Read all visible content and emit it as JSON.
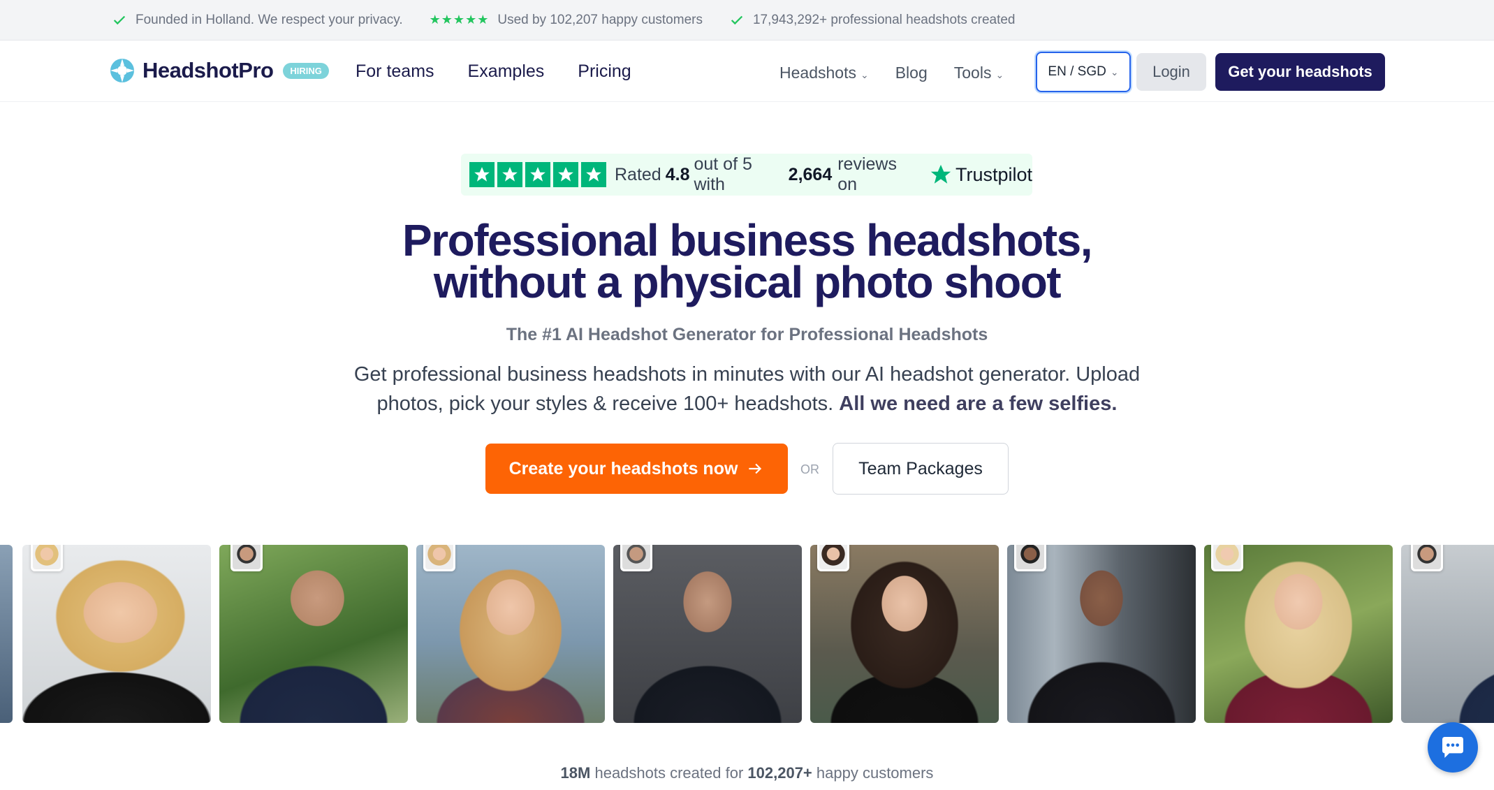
{
  "topbar": {
    "privacy": "Founded in Holland. We respect your privacy.",
    "stars": "★★★★★",
    "customers": "Used by 102,207 happy customers",
    "created": "17,943,292+ professional headshots created"
  },
  "nav": {
    "logo": "HeadshotPro",
    "hiring": "HIRING",
    "links": [
      "For teams",
      "Examples",
      "Pricing"
    ],
    "headshots": "Headshots",
    "blog": "Blog",
    "tools": "Tools",
    "lang": "EN / SGD",
    "login": "Login",
    "cta": "Get your headshots"
  },
  "trust": {
    "prefix": "Rated",
    "rating": "4.8",
    "mid": "out of 5 with",
    "count": "2,664",
    "suffix": "reviews on",
    "brand": "Trustpilot"
  },
  "hero": {
    "title_line1": "Professional business headshots,",
    "title_line2": "without a physical photo shoot",
    "subhead": "The #1 AI Headshot Generator for Professional Headshots",
    "desc": "Get professional business headshots in minutes with our AI headshot generator. Upload photos, pick your styles & receive 100+ headshots.",
    "desc_bold": "All we need are a few selfies.",
    "cta": "Create your headshots now",
    "or": "OR",
    "team": "Team Packages"
  },
  "stats": {
    "count": "18M",
    "mid": "headshots created for",
    "customers": "102,207+",
    "suffix": "happy customers"
  },
  "colors": {
    "brand": "#1e1b5e",
    "accent": "#fd6405",
    "trustpilot": "#00b67a",
    "chat": "#1d6fe0"
  }
}
